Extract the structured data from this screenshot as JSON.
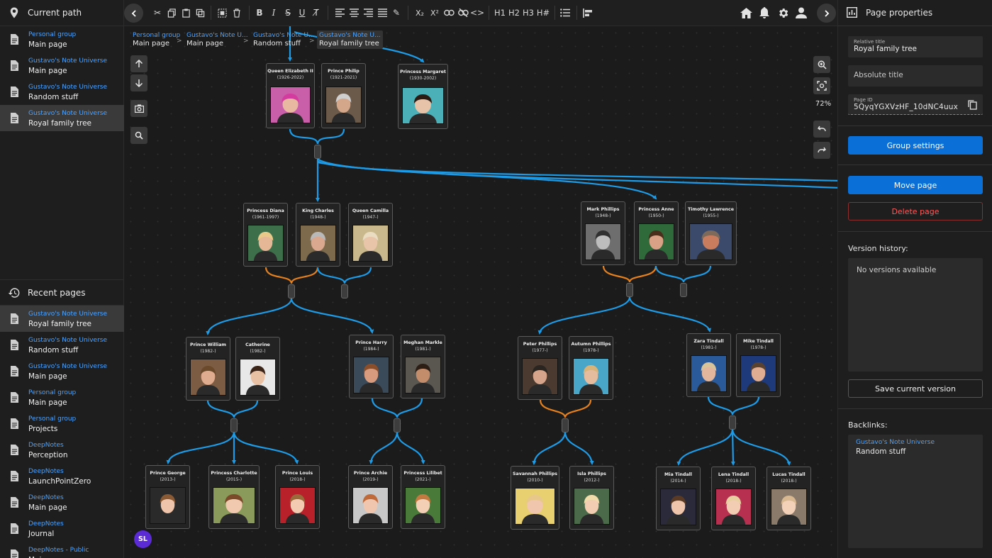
{
  "left": {
    "current_path_title": "Current path",
    "current_path": [
      {
        "group": "Personal group",
        "page": "Main page"
      },
      {
        "group": "Gustavo's Note Universe",
        "page": "Main page"
      },
      {
        "group": "Gustavo's Note Universe",
        "page": "Random stuff"
      },
      {
        "group": "Gustavo's Note Universe",
        "page": "Royal family tree"
      }
    ],
    "recent_title": "Recent pages",
    "recent": [
      {
        "group": "Gustavo's Note Universe",
        "page": "Royal family tree"
      },
      {
        "group": "Gustavo's Note Universe",
        "page": "Random stuff"
      },
      {
        "group": "Gustavo's Note Universe",
        "page": "Main page"
      },
      {
        "group": "Personal group",
        "page": "Main page"
      },
      {
        "group": "Personal group",
        "page": "Projects"
      },
      {
        "group": "DeepNotes",
        "page": "Perception"
      },
      {
        "group": "DeepNotes",
        "page": "LaunchPointZero"
      },
      {
        "group": "DeepNotes",
        "page": "Main page"
      },
      {
        "group": "DeepNotes",
        "page": "Journal"
      },
      {
        "group": "DeepNotes - Public",
        "page": "Main page"
      }
    ]
  },
  "toolbar": {
    "headings": [
      "H1",
      "H2",
      "H3",
      "H#"
    ]
  },
  "breadcrumb": [
    {
      "group": "Personal group",
      "page": "Main page"
    },
    {
      "group": "Gustavo's Note U...",
      "page": "Main page"
    },
    {
      "group": "Gustavo's Note U...",
      "page": "Random stuff"
    },
    {
      "group": "Gustavo's Note U...",
      "page": "Royal family tree"
    }
  ],
  "zoom": "72%",
  "avatar": "SL",
  "people": [
    {
      "name": "Queen Elizabeth II",
      "years": "(1926-2022)",
      "skin": "#e8b8a0",
      "bg": "#c85fa8",
      "hair": "#d43b9e"
    },
    {
      "name": "Prince Philip",
      "years": "(1921-2021)",
      "skin": "#d4a68a",
      "bg": "#6b5a4a",
      "hair": "#cfcfcf"
    },
    {
      "name": "Princess Margaret",
      "years": "(1930-2002)",
      "skin": "#e7c3aa",
      "bg": "#4bb0b8",
      "hair": "#2a1c14"
    },
    {
      "name": "Princess Diana",
      "years": "(1961-1997)",
      "skin": "#e5b797",
      "bg": "#3c6f4a",
      "hair": "#e8c98a"
    },
    {
      "name": "King Charles",
      "years": "(1948-)",
      "skin": "#d9a88e",
      "bg": "#7d6a4d",
      "hair": "#b9b9b9"
    },
    {
      "name": "Queen Camilla",
      "years": "(1947-)",
      "skin": "#e8c4a8",
      "bg": "#c9b88c",
      "hair": "#e9dcc0"
    },
    {
      "name": "Mark Phillips",
      "years": "(1948-)",
      "skin": "#bdbdbd",
      "bg": "#6e6e6e",
      "hair": "#303030"
    },
    {
      "name": "Princess Anne",
      "years": "(1950-)",
      "skin": "#d9a185",
      "bg": "#2f6b3a",
      "hair": "#4a2e1c"
    },
    {
      "name": "Timothy Lawrence",
      "years": "(1955-)",
      "skin": "#c97d5e",
      "bg": "#3b4a6a",
      "hair": "#7d6a5a"
    },
    {
      "name": "Prince William",
      "years": "(1982-)",
      "skin": "#e0ac90",
      "bg": "#7d5c44",
      "hair": "#6b4a2c"
    },
    {
      "name": "Catherine",
      "years": "(1982-)",
      "skin": "#e8c0a4",
      "bg": "#e8e8e8",
      "hair": "#3a2418"
    },
    {
      "name": "Prince Harry",
      "years": "(1984-)",
      "skin": "#d99b7d",
      "bg": "#3a4a58",
      "hair": "#8a4e2a"
    },
    {
      "name": "Meghan Markle",
      "years": "(1981-)",
      "skin": "#c38d6c",
      "bg": "#5a5650",
      "hair": "#2c1e14"
    },
    {
      "name": "Peter Phillips",
      "years": "(1977-)",
      "skin": "#d6a48a",
      "bg": "#4a3a30",
      "hair": "#2a2520"
    },
    {
      "name": "Autumn Phillips",
      "years": "(1978-)",
      "skin": "#e5bc9d",
      "bg": "#49a6c8",
      "hair": "#d8b37a"
    },
    {
      "name": "Zara Tindall",
      "years": "(1981-)",
      "skin": "#e2b69c",
      "bg": "#2a5a9a",
      "hair": "#d7c49a"
    },
    {
      "name": "Mike Tindall",
      "years": "(1978-)",
      "skin": "#e0ad92",
      "bg": "#1f3a7a",
      "hair": "#5a4230"
    },
    {
      "name": "Prince George",
      "years": "(2013-)",
      "skin": "#eec4aa",
      "bg": "#2a2a2a",
      "hair": "#8a5a34"
    },
    {
      "name": "Princess Charlotte",
      "years": "(2015-)",
      "skin": "#f0c9ae",
      "bg": "#8a9a5a",
      "hair": "#7a4a2a"
    },
    {
      "name": "Prince Louis",
      "years": "(2018-)",
      "skin": "#f2cbb0",
      "bg": "#b8202a",
      "hair": "#9a6a3a"
    },
    {
      "name": "Prince Archie",
      "years": "(2019-)",
      "skin": "#f0c7ae",
      "bg": "#c8c8c8",
      "hair": "#c06a3a"
    },
    {
      "name": "Princess Lilibet",
      "years": "(2021-)",
      "skin": "#f2cfb5",
      "bg": "#4a7a3a",
      "hair": "#c27a40"
    },
    {
      "name": "Savannah Phillips",
      "years": "(2010-)",
      "skin": "#f0c7ad",
      "bg": "#e8d070",
      "hair": "#e8c88a"
    },
    {
      "name": "Isla Phillips",
      "years": "(2012-)",
      "skin": "#f2cdb2",
      "bg": "#4a6a4a",
      "hair": "#f0dcaa"
    },
    {
      "name": "Mia Tindall",
      "years": "(2014-)",
      "skin": "#efc6ab",
      "bg": "#2a2a3a",
      "hair": "#5a3a24"
    },
    {
      "name": "Lena Tindall",
      "years": "(2018-)",
      "skin": "#f2cdb3",
      "bg": "#b83050",
      "hair": "#e8d0a0"
    },
    {
      "name": "Lucas Tindall",
      "years": "(2018-)",
      "skin": "#f3d0b8",
      "bg": "#8a7a6a",
      "hair": "#d8b890"
    }
  ],
  "right": {
    "title": "Page properties",
    "relative_title_label": "Relative title",
    "relative_title_value": "Royal family tree",
    "absolute_title_placeholder": "Absolute title",
    "page_id_label": "Page ID",
    "page_id_value": "5QyqYGXVzHF_10dNC4uux",
    "group_settings": "Group settings",
    "move_page": "Move page",
    "delete_page": "Delete page",
    "version_history_label": "Version history:",
    "no_versions": "No versions available",
    "save_version": "Save current version",
    "backlinks_label": "Backlinks:",
    "backlink": {
      "group": "Gustavo's Note Universe",
      "page": "Random stuff"
    }
  },
  "colors": {
    "accent": "#0a6fd6",
    "wire": "#1e9be6",
    "wire_spouse": "#e5801d",
    "danger": "#ff5a5a"
  }
}
